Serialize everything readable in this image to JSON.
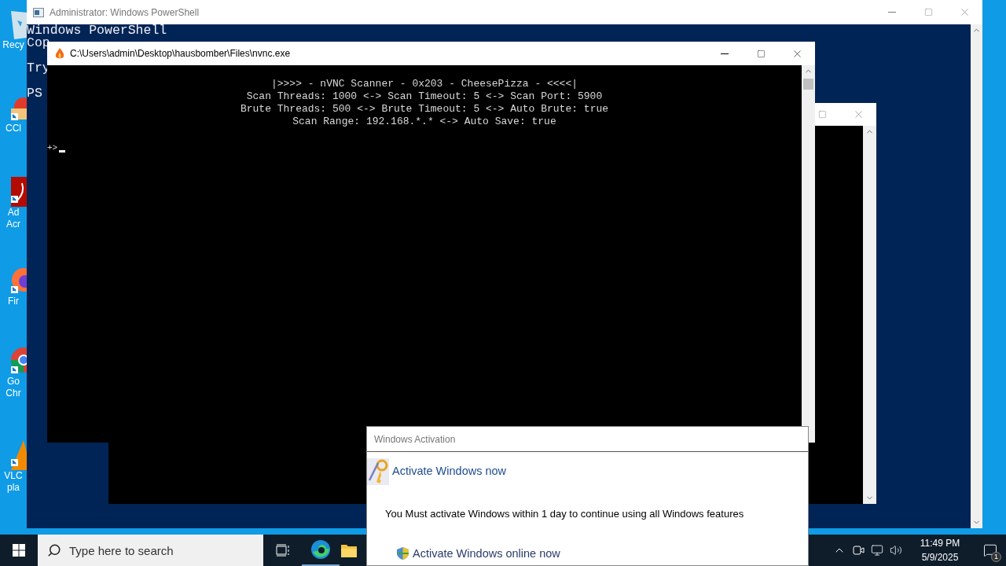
{
  "desktop_icons": [
    {
      "kind": "recycle",
      "labels": [
        "Recy"
      ]
    },
    {
      "kind": "cleaner",
      "labels": [
        "CCl"
      ]
    },
    {
      "kind": "acrobat",
      "labels": [
        "Ad",
        "Acr"
      ]
    },
    {
      "kind": "firefox",
      "labels": [
        "Fir"
      ]
    },
    {
      "kind": "chrome",
      "labels": [
        "Go",
        "Chr"
      ]
    },
    {
      "kind": "vlc",
      "labels": [
        "VLC",
        "pla"
      ]
    }
  ],
  "powershell": {
    "title": "Administrator: Windows PowerShell",
    "blocks": [
      [
        "Windows PowerShell",
        "Cop"
      ],
      [
        "Try"
      ],
      [
        "PS"
      ]
    ]
  },
  "scanner": {
    "title": "C:\\Users\\admin\\Desktop\\hausbomber\\Files\\nvnc.exe",
    "header": [
      "|>>>> - nVNC Scanner - 0x203 - CheesePizza - <<<<|",
      "Scan Threads: 1000 <-> Scan Timeout: 5 <-> Scan Port: 5900",
      "Brute Threads: 500 <-> Brute Timeout: 5 <-> Auto Brute: true",
      "Scan Range: 192.168.*.* <-> Auto Save: true"
    ],
    "prompt": "+>"
  },
  "activation": {
    "title": "Windows Activation",
    "heading": "Activate Windows now",
    "message": "You Must activate Windows within 1 day to continue using all Windows features",
    "link": "Activate Windows online now"
  },
  "taskbar": {
    "search_placeholder": "Type here to search",
    "time": "11:49 PM",
    "date": "5/9/2025",
    "notification_count": "1"
  }
}
